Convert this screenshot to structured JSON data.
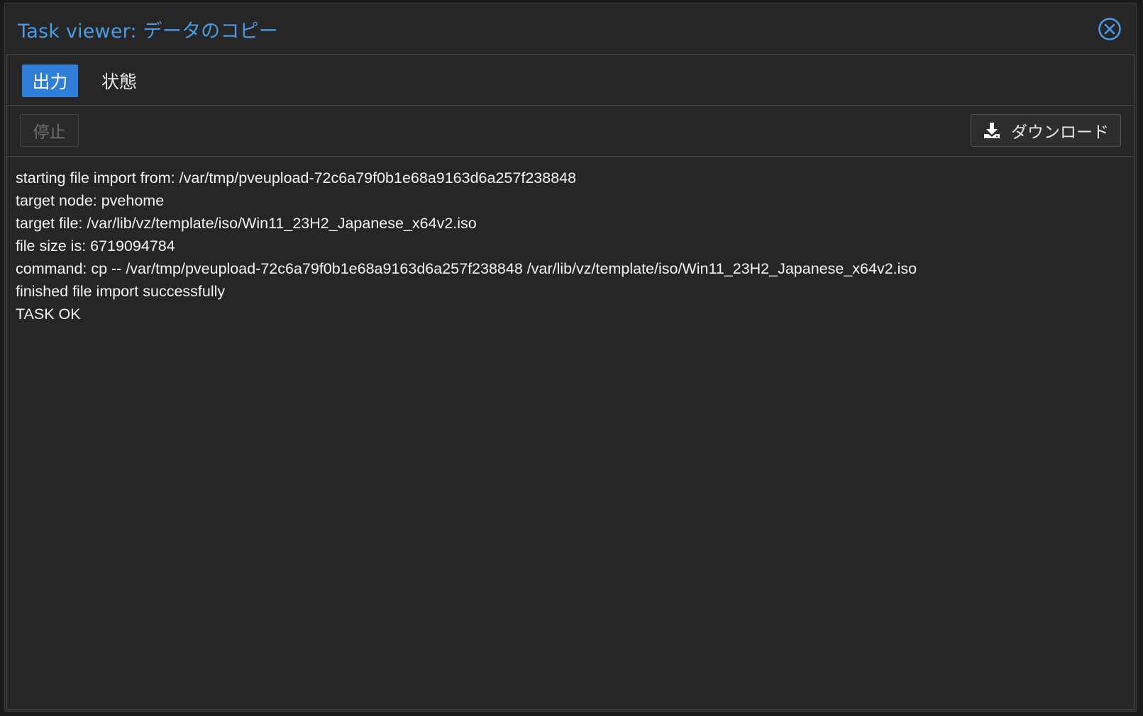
{
  "window": {
    "title": "Task viewer: データのコピー",
    "close_label": "Close"
  },
  "tabs": [
    {
      "label": "出力",
      "active": true
    },
    {
      "label": "状態",
      "active": false
    }
  ],
  "toolbar": {
    "stop_label": "停止",
    "stop_disabled": true,
    "download_label": "ダウンロード",
    "download_icon": "download-icon"
  },
  "log": {
    "lines": [
      "starting file import from: /var/tmp/pveupload-72c6a79f0b1e68a9163d6a257f238848",
      "target node: pvehome",
      "target file: /var/lib/vz/template/iso/Win11_23H2_Japanese_x64v2.iso",
      "file size is: 6719094784",
      "command: cp -- /var/tmp/pveupload-72c6a79f0b1e68a9163d6a257f238848 /var/lib/vz/template/iso/Win11_23H2_Japanese_x64v2.iso",
      "finished file import successfully",
      "TASK OK"
    ]
  },
  "colors": {
    "accent": "#2f7fd8",
    "title": "#4a9be6",
    "background": "#262626",
    "text": "#f2f2f2"
  }
}
